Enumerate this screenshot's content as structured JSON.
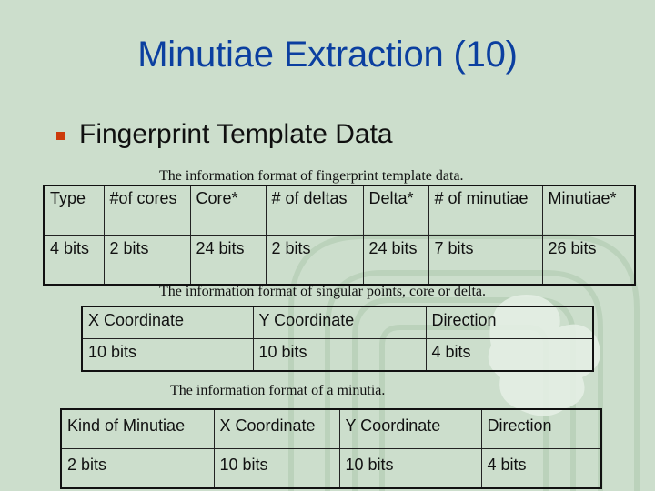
{
  "slide": {
    "title": "Minutiae Extraction  (10)",
    "bullet": "Fingerprint Template Data"
  },
  "template_table": {
    "caption": "The information format of fingerprint template data.",
    "headers": [
      "Type",
      "#of cores",
      "Core*",
      "# of deltas",
      "Delta*",
      "# of minutiae",
      "Minutiae*"
    ],
    "values": [
      "4 bits",
      "2 bits",
      "24 bits",
      "2 bits",
      "24 bits",
      "7 bits",
      "26 bits"
    ]
  },
  "singular_table": {
    "caption": "The information format of singular points, core or delta.",
    "headers": [
      "X Coordinate",
      "Y Coordinate",
      "Direction"
    ],
    "values": [
      "10 bits",
      "10 bits",
      "4 bits"
    ]
  },
  "minutia_table": {
    "caption": "The information format of a minutia.",
    "headers": [
      "Kind of Minutiae",
      "X Coordinate",
      "Y Coordinate",
      "Direction"
    ],
    "values": [
      "2 bits",
      "10 bits",
      "10 bits",
      "4 bits"
    ]
  },
  "colors": {
    "background": "#ccdecc",
    "title": "#0b3fa0",
    "bullet": "#cc3a0a"
  }
}
